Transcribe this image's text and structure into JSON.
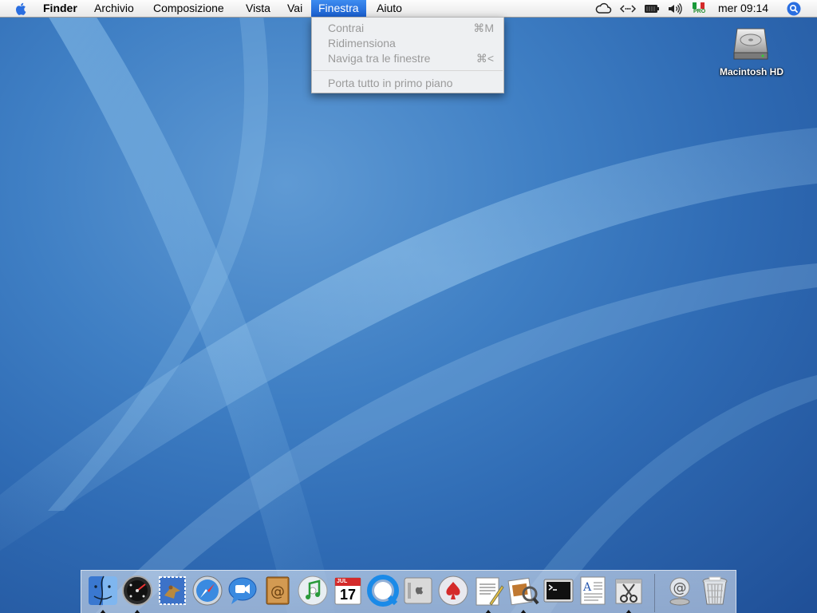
{
  "menubar": {
    "app_name": "Finder",
    "menus": [
      "Archivio",
      "Composizione",
      "Vista",
      "Vai",
      "Finestra",
      "Aiuto"
    ],
    "active_menu": "Finestra",
    "status_icons": [
      "icloud-icon",
      "network-icon",
      "battery-icon",
      "volume-icon",
      "input-flag-icon",
      "spotlight-icon"
    ],
    "input_flag_label": "PRO",
    "clock": "mer 09:14"
  },
  "window_menu": {
    "items": [
      {
        "label": "Contrai",
        "shortcut": "⌘M",
        "enabled": false
      },
      {
        "label": "Ridimensiona",
        "shortcut": "",
        "enabled": false
      },
      {
        "label": "Naviga tra le finestre",
        "shortcut": "⌘<",
        "enabled": false
      },
      {
        "label": "Porta tutto in primo piano",
        "shortcut": "",
        "enabled": false
      }
    ]
  },
  "desktop": {
    "icons": [
      {
        "label": "Macintosh HD",
        "icon": "hard-drive-icon"
      }
    ]
  },
  "dock": {
    "apps": [
      {
        "name": "finder",
        "icon": "finder-icon",
        "running": true
      },
      {
        "name": "dashboard",
        "icon": "dashboard-icon",
        "running": true
      },
      {
        "name": "mail",
        "icon": "mail-icon",
        "running": false
      },
      {
        "name": "safari",
        "icon": "safari-icon",
        "running": false
      },
      {
        "name": "ichat",
        "icon": "ichat-icon",
        "running": false
      },
      {
        "name": "address-book",
        "icon": "address-book-icon",
        "running": false
      },
      {
        "name": "itunes",
        "icon": "itunes-icon",
        "running": false
      },
      {
        "name": "ical",
        "icon": "ical-icon",
        "running": false,
        "date_text": "17",
        "month_text": "JUL"
      },
      {
        "name": "quicktime",
        "icon": "quicktime-icon",
        "running": false
      },
      {
        "name": "system-preferences",
        "icon": "system-preferences-icon",
        "running": false
      },
      {
        "name": "solitaire",
        "icon": "spade-icon",
        "running": false
      },
      {
        "name": "textedit",
        "icon": "textedit-icon",
        "running": true
      },
      {
        "name": "preview",
        "icon": "preview-icon",
        "running": true
      },
      {
        "name": "terminal",
        "icon": "terminal-icon",
        "running": false
      },
      {
        "name": "font-book",
        "icon": "font-book-icon",
        "running": false
      },
      {
        "name": "utility",
        "icon": "scissors-icon",
        "running": true
      }
    ],
    "docs": [
      {
        "name": "internet-location",
        "icon": "at-sign-icon"
      },
      {
        "name": "trash",
        "icon": "trash-icon"
      }
    ]
  },
  "colors": {
    "menu_highlight": "#2a6ee0",
    "desktop_blue": "#3f7fc4"
  }
}
